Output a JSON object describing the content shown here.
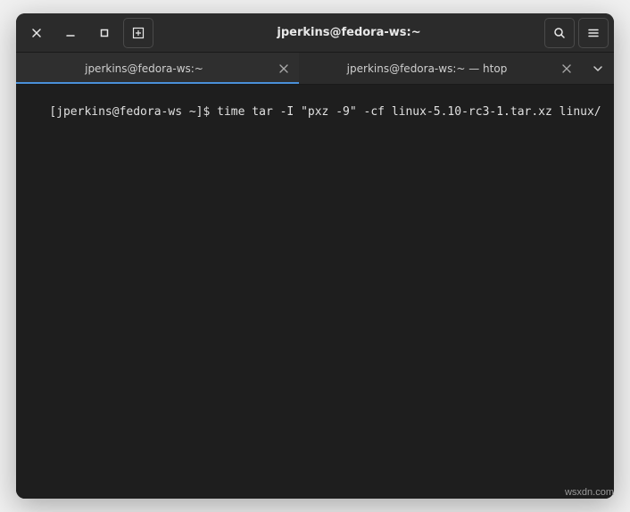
{
  "titlebar": {
    "title": "jperkins@fedora-ws:~"
  },
  "tabs": [
    {
      "label": "jperkins@fedora-ws:~",
      "active": true
    },
    {
      "label": "jperkins@fedora-ws:~ — htop",
      "active": false
    }
  ],
  "terminal": {
    "prompt": "[jperkins@fedora-ws ~]$ ",
    "command": "time tar -I \"pxz -9\" -cf linux-5.10-rc3-1.tar.xz linux/"
  },
  "watermark": "wsxdn.com"
}
